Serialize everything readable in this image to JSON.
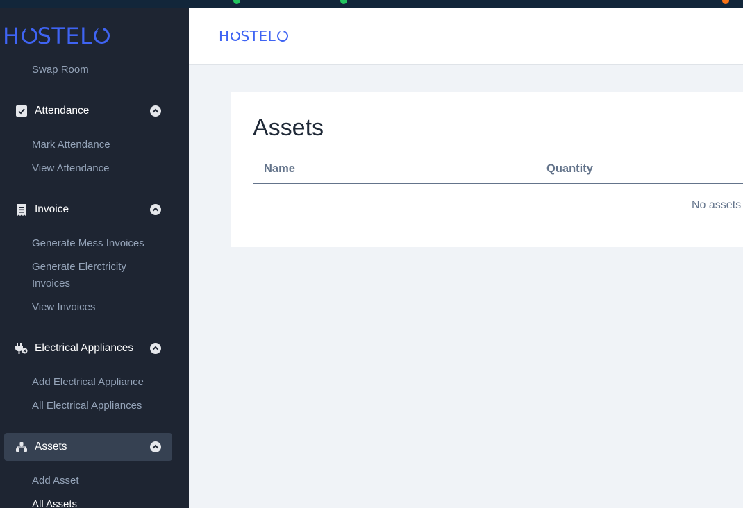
{
  "brand": {
    "name_start": "H",
    "name_mid": "STEL"
  },
  "sidebar": {
    "top_item": "Swap Room",
    "sections": [
      {
        "label": "Attendance",
        "icon": "check-square-icon",
        "items": [
          "Mark Attendance",
          "View Attendance"
        ]
      },
      {
        "label": "Invoice",
        "icon": "receipt-icon",
        "items": [
          "Generate Mess Invoices",
          "Generate Elerctricity",
          "Invoices",
          "View Invoices"
        ]
      },
      {
        "label": "Electrical Appliances",
        "icon": "plug-icon",
        "items": [
          "Add Electrical Appliance",
          "All Electrical Appliances"
        ]
      },
      {
        "label": "Assets",
        "icon": "assets-icon",
        "items": [
          "Add Asset",
          "All Assets"
        ]
      }
    ]
  },
  "main": {
    "title": "Assets",
    "columns": [
      "Name",
      "Quantity"
    ],
    "empty_message": "No assets"
  },
  "colors": {
    "sidebar_bg": "#1e2532",
    "brand_blue": "#3f64f3",
    "active_bg": "#364152"
  }
}
